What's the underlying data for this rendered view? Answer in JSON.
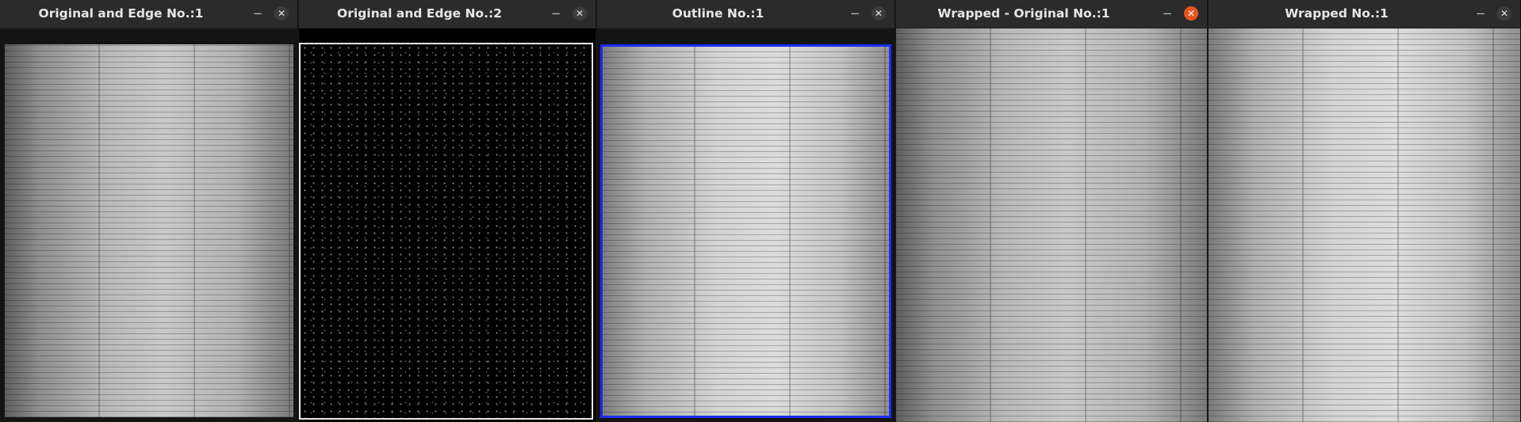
{
  "windows": [
    {
      "title": "Original and Edge No.:1"
    },
    {
      "title": "Original and Edge No.:2"
    },
    {
      "title": "Outline No.:1"
    },
    {
      "title": "Wrapped - Original No.:1"
    },
    {
      "title": "Wrapped No.:1"
    }
  ],
  "controls": {
    "minimize": "−",
    "close": "✕"
  },
  "colors": {
    "close_active": "#e95420",
    "outline": "#1b2cff"
  }
}
